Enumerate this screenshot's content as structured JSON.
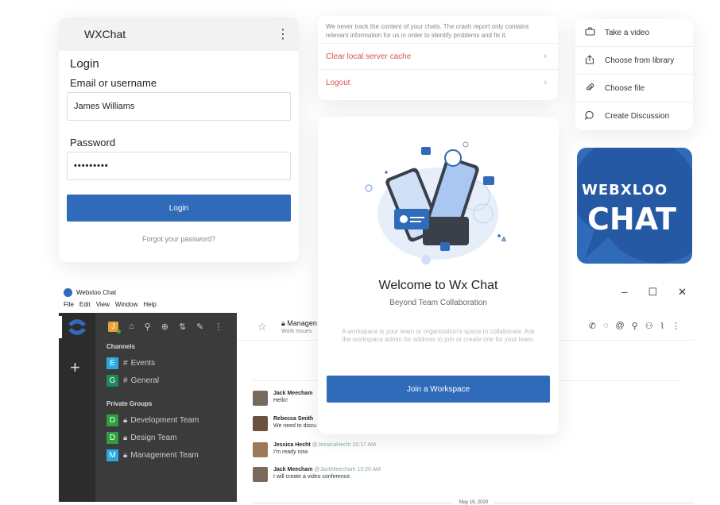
{
  "login": {
    "app_title": "WXChat",
    "heading": "Login",
    "email_label": "Email or username",
    "email_value": "James Williams",
    "password_label": "Password",
    "password_value": "•••••••••",
    "login_button": "Login",
    "forgot_link": "Forgot your password?"
  },
  "settings": {
    "note": "We never track the content of your chats. The crash report only contains relevant information for us in order to identify problems and fix it.",
    "clear_cache": "Clear local server cache",
    "logout": "Logout"
  },
  "attach_menu": {
    "items": [
      {
        "label": "Take a video",
        "icon": "camera-icon"
      },
      {
        "label": "Choose from library",
        "icon": "share-icon"
      },
      {
        "label": "Choose file",
        "icon": "paperclip-icon"
      },
      {
        "label": "Create Discussion",
        "icon": "discussion-icon"
      }
    ]
  },
  "logo": {
    "line1": "WEBXLOO",
    "line2": "CHAT",
    "bg": "#2f6bb8"
  },
  "desktop": {
    "window_title": "Webxloo Chat",
    "menu": [
      "File",
      "Edit",
      "View",
      "Window",
      "Help"
    ],
    "sidebar": {
      "avatar_initial": "J",
      "channels_label": "Channels",
      "channels": [
        {
          "letter": "E",
          "name": "Events",
          "color": "#29a9e0"
        },
        {
          "letter": "G",
          "name": "General",
          "color": "#1b8a5a"
        }
      ],
      "private_label": "Private Groups",
      "groups": [
        {
          "letter": "D",
          "name": "Development Team",
          "color": "#2e9e3e"
        },
        {
          "letter": "D",
          "name": "Design Team",
          "color": "#2e9e3e"
        },
        {
          "letter": "M",
          "name": "Management Team",
          "color": "#29a9e0"
        }
      ]
    },
    "chat": {
      "room_name": "Managen",
      "room_topic": "Work Issues",
      "messages": [
        {
          "name": "Jack Meecham",
          "handle": "",
          "text": "Hello!"
        },
        {
          "name": "Rebecca Smith",
          "handle": "",
          "text": "We need to discu"
        },
        {
          "name": "Jessica Hecht",
          "handle": "@JessicaHecht 10:17 AM",
          "text": "I'm ready now"
        },
        {
          "name": "Jack Meecham",
          "handle": "@JackMeecham 10:20 AM",
          "text": "I will create a video conference."
        }
      ],
      "date_divider": "May 15, 2020"
    }
  },
  "welcome": {
    "title": "Welcome to Wx Chat",
    "subtitle": "Beyond Team Collaboration",
    "description": "A workspace is your team or organization's space to collaborate. Ask the workspace admin for address to join or create one for your team.",
    "join_button": "Join a Workspace"
  },
  "colors": {
    "primary": "#2f6bb8",
    "danger": "#d9534f",
    "dark_rail": "#2c2c2c",
    "dark_sidebar": "#3b3b3b"
  }
}
